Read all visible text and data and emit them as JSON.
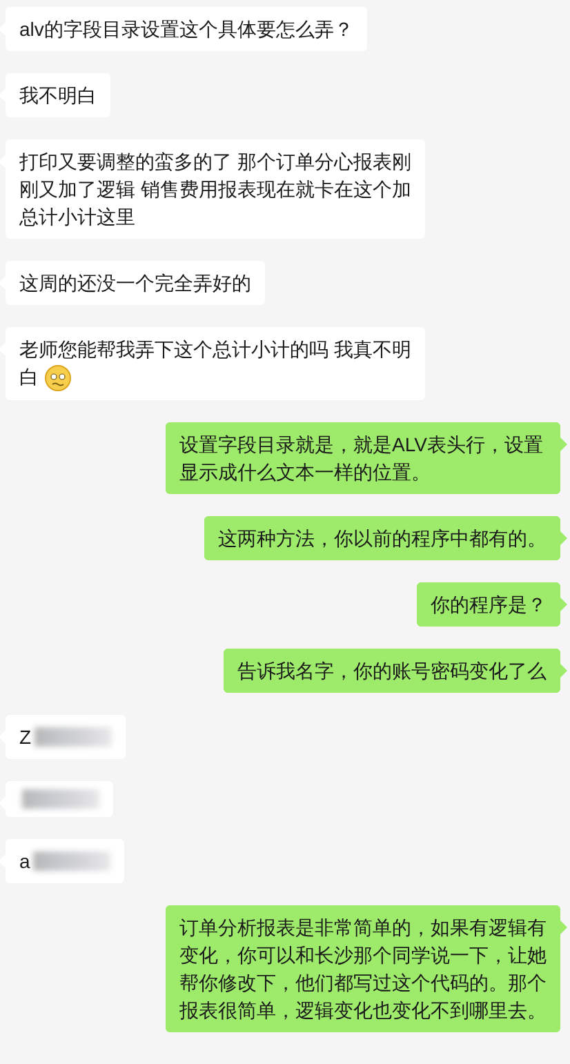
{
  "messages": [
    {
      "kind": "incoming_text",
      "text": "alv的字段目录设置这个具体要怎么弄？"
    },
    {
      "kind": "incoming_text",
      "text": "我不明白"
    },
    {
      "kind": "incoming_text",
      "text": "打印又要调整的蛮多的了  那个订单分心报表刚刚又加了逻辑   销售费用报表现在就卡在这个加总计小计这里"
    },
    {
      "kind": "incoming_text",
      "text": "这周的还没一个完全弄好的"
    },
    {
      "kind": "incoming_text",
      "text": "老师您能帮我弄下这个总计小计的吗  我真不明白",
      "has_emoji": true
    },
    {
      "kind": "outgoing_text",
      "text": "设置字段目录就是，就是ALV表头行，设置显示成什么文本一样的位置。"
    },
    {
      "kind": "outgoing_text",
      "text": "这两种方法，你以前的程序中都有的。"
    },
    {
      "kind": "outgoing_text",
      "text": "你的程序是？"
    },
    {
      "kind": "outgoing_text",
      "text": "告诉我名字，你的账号密码变化了么"
    },
    {
      "kind": "incoming_blurred",
      "text": "Z"
    },
    {
      "kind": "incoming_blurred"
    },
    {
      "kind": "incoming_blurred",
      "text": "a"
    },
    {
      "kind": "outgoing_text",
      "text": "订单分析报表是非常简单的，如果有逻辑有变化，你可以和长沙那个同学说一下，让她帮你修改下，他们都写过这个代码的。那个报表很简单，逻辑变化也变化不到哪里去。"
    }
  ]
}
